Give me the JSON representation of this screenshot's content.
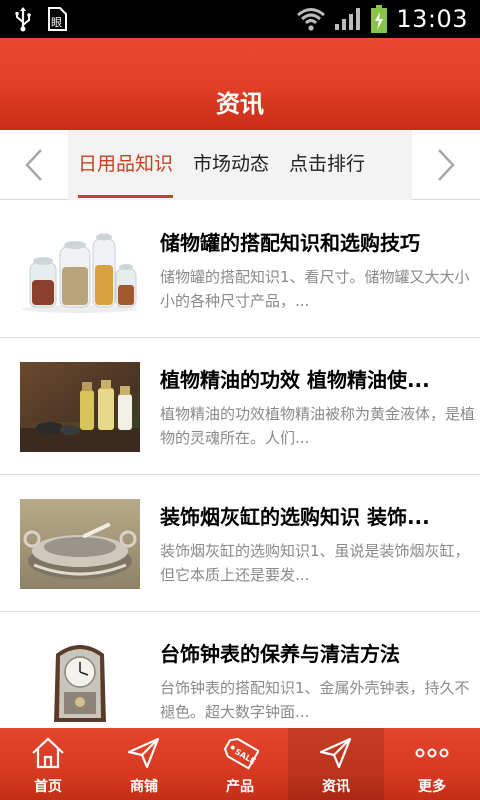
{
  "status_bar": {
    "time": "13:03"
  },
  "header": {
    "title": "资讯"
  },
  "tabs": [
    {
      "label": "日用品知识",
      "active": true
    },
    {
      "label": "市场动态",
      "active": false
    },
    {
      "label": "点击排行",
      "active": false
    }
  ],
  "articles": [
    {
      "title": "储物罐的搭配知识和选购技巧",
      "desc": "储物罐的搭配知识1、看尺寸。储物罐又大大小小的各种尺寸产品，...",
      "image": "glass-jars"
    },
    {
      "title": "植物精油的功效 植物精油使...",
      "desc": "植物精油的功效植物精油被称为黄金液体，是植物的灵魂所在。人们...",
      "image": "essential-oil-bottles"
    },
    {
      "title": "装饰烟灰缸的选购知识 装饰...",
      "desc": "装饰烟灰缸的选购知识1、虽说是装饰烟灰缸，但它本质上还是要发...",
      "image": "ashtray"
    },
    {
      "title": "台饰钟表的保养与清洁方法",
      "desc": "台饰钟表的搭配知识1、金属外壳钟表，持久不褪色。超大数字钟面...",
      "image": "table-clock"
    }
  ],
  "bottom_nav": [
    {
      "label": "首页",
      "icon": "home-icon",
      "active": false
    },
    {
      "label": "商铺",
      "icon": "send-icon",
      "active": false
    },
    {
      "label": "产品",
      "icon": "sale-tag-icon",
      "active": false
    },
    {
      "label": "资讯",
      "icon": "send-icon",
      "active": true
    },
    {
      "label": "更多",
      "icon": "more-dots-icon",
      "active": false
    }
  ],
  "colors": {
    "brand_red": "#e03e25",
    "active_tab": "#c9411f",
    "desc_gray": "#8a8a8a"
  }
}
